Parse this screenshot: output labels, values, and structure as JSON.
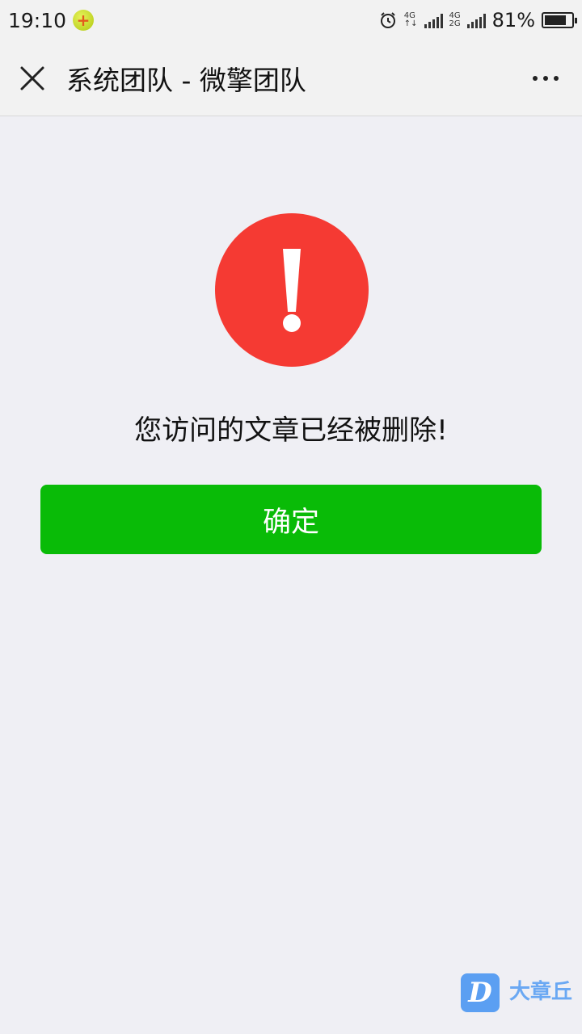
{
  "status_bar": {
    "time": "19:10",
    "network_top": "4G",
    "network_bottom": "2G",
    "battery_percent": "81%",
    "battery_level": 0.81
  },
  "navbar": {
    "title": "系统团队 - 微擎团队"
  },
  "alert": {
    "message": "您访问的文章已经被删除!",
    "confirm_label": "确定",
    "icon_color": "#f53a33",
    "button_color": "#09bb07"
  },
  "watermark": {
    "logo_letter": "D",
    "text": "大章丘"
  },
  "icons": {
    "close": "close-icon",
    "more": "more-icon",
    "alarm": "alarm-icon",
    "warning": "exclamation-icon"
  }
}
